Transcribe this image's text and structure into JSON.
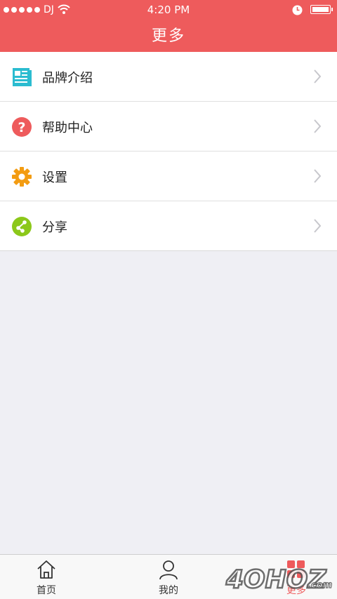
{
  "status_bar": {
    "carrier": "DJ",
    "time": "4:20 PM"
  },
  "header": {
    "title": "更多"
  },
  "menu": {
    "items": [
      {
        "label": "品牌介绍",
        "icon": "brand-info-icon",
        "color": "#2bbcd0"
      },
      {
        "label": "帮助中心",
        "icon": "help-icon",
        "color": "#ee5b5c"
      },
      {
        "label": "设置",
        "icon": "gear-icon",
        "color": "#f39c12"
      },
      {
        "label": "分享",
        "icon": "share-icon",
        "color": "#8cc81a"
      }
    ]
  },
  "tabbar": {
    "tabs": [
      {
        "label": "首页",
        "icon": "home-icon"
      },
      {
        "label": "我的",
        "icon": "user-icon"
      },
      {
        "label": "更多",
        "icon": "more-grid-icon",
        "active": true
      }
    ]
  },
  "watermark": {
    "text": "4OHOZ.com"
  },
  "colors": {
    "accent": "#ee5b5c",
    "background": "#efeff4"
  }
}
